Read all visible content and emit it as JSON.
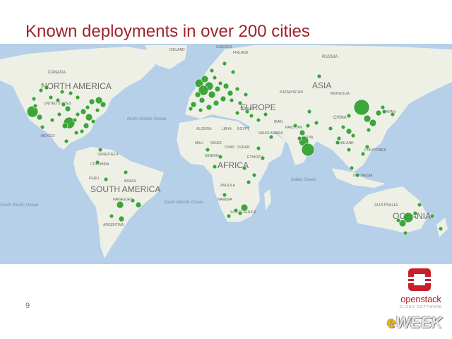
{
  "slide": {
    "title": "Known deployments in over 200 cities",
    "page_number": "9"
  },
  "map": {
    "continents": [
      "NORTH AMERICA",
      "SOUTH AMERICA",
      "AFRICA",
      "ASIA",
      "OCEANIA",
      "EUROPE"
    ],
    "oceans": [
      "North Atlantic Ocean",
      "South Atlantic Ocean",
      "South Pacific Ocean",
      "Indian Ocean"
    ],
    "countries": [
      "ICELAND",
      "SWEDEN",
      "FINLAND",
      "RUSSIA",
      "CANADA",
      "UNITED STATES",
      "MEXICO",
      "KAZAKHSTAN",
      "MONGOLIA",
      "CHINA",
      "JAPAN",
      "IRAN",
      "PAKISTAN",
      "INDIA",
      "SAUDI ARABIA",
      "ALGERIA",
      "LIBYA",
      "EGYPT",
      "MALI",
      "NIGER",
      "SUDAN",
      "CHAD",
      "ETHIOPIA",
      "NIGERIA",
      "ANGOLA",
      "NAMIBIA",
      "SOUTH AFRICA",
      "VENEZUELA",
      "COLOMBIA",
      "PERU",
      "BRAZIL",
      "ARGENTINA",
      "PARAGUAY",
      "AUSTRALIA",
      "TURKEY",
      "INDONESIA",
      "PHILIPPINES",
      "THAILAND"
    ],
    "colors": {
      "ocean": "#b5d0e8",
      "land": "#eef0e6",
      "marker": "#2f9e2f",
      "title": "#a0232b"
    }
  },
  "logo": {
    "name": "openstack",
    "tagline": "CLOUD SOFTWARE"
  },
  "watermark": {
    "prefix": "e",
    "text": "WEEK"
  }
}
